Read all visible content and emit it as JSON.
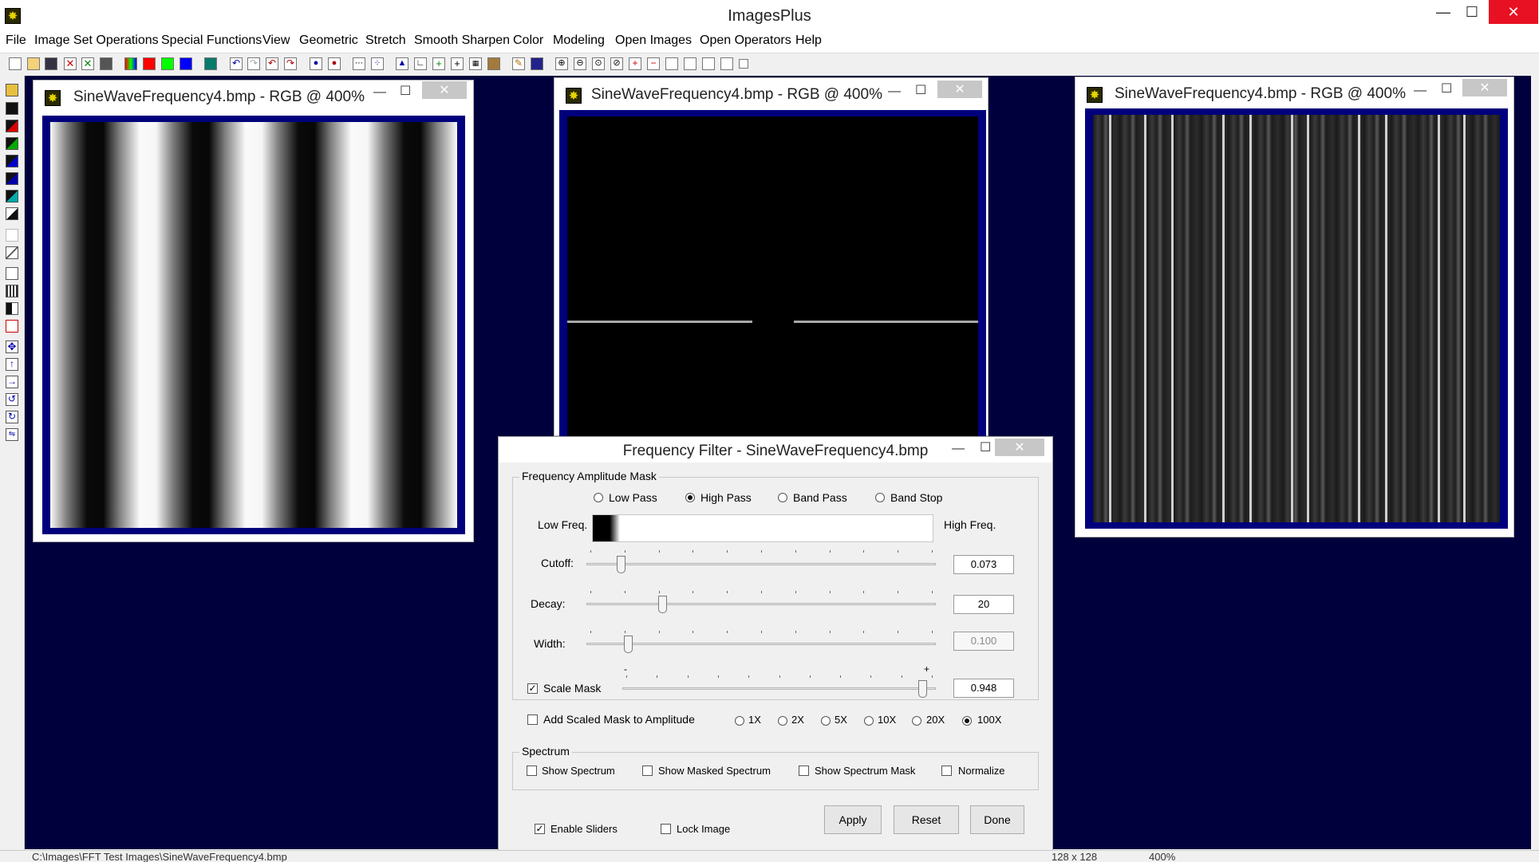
{
  "app": {
    "title": "ImagesPlus",
    "window_buttons": {
      "minimize": "—",
      "maximize": "☐",
      "close": "✕"
    }
  },
  "menu": [
    "File",
    "Image Set Operations",
    "Special Functions",
    "View",
    "Geometric",
    "Stretch",
    "Smooth Sharpen",
    "Color",
    "Modeling",
    "Open Images",
    "Open Operators",
    "Help"
  ],
  "image_windows": [
    {
      "title": "SineWaveFrequency4.bmp - RGB @ 400%"
    },
    {
      "title": "SineWaveFrequency4.bmp - RGB @ 400%"
    },
    {
      "title": "SineWaveFrequency4.bmp - RGB @ 400%"
    }
  ],
  "dialog": {
    "title": "Frequency Filter - SineWaveFrequency4.bmp",
    "amplitude_group": "Frequency Amplitude Mask",
    "filter_types": [
      "Low Pass",
      "High Pass",
      "Band Pass",
      "Band Stop"
    ],
    "selected_filter": "High Pass",
    "low_freq_label": "Low Freq.",
    "high_freq_label": "High Freq.",
    "cutoff": {
      "label": "Cutoff:",
      "value": "0.073",
      "position": 0.09
    },
    "decay": {
      "label": "Decay:",
      "value": "20",
      "position": 0.21
    },
    "width": {
      "label": "Width:",
      "value": "0.100",
      "position": 0.11,
      "disabled": true
    },
    "scale_mask": {
      "label": "Scale Mask",
      "checked": true,
      "value": "0.948",
      "position": 0.97,
      "minus": "-",
      "plus": "+"
    },
    "add_scaled": {
      "label": "Add Scaled Mask to Amplitude",
      "checked": false
    },
    "multipliers": [
      "1X",
      "2X",
      "5X",
      "10X",
      "20X",
      "100X"
    ],
    "selected_multiplier": "100X",
    "spectrum_group": "Spectrum",
    "spectrum_options": [
      {
        "label": "Show Spectrum",
        "checked": false
      },
      {
        "label": "Show Masked Spectrum",
        "checked": false
      },
      {
        "label": "Show Spectrum Mask",
        "checked": false
      },
      {
        "label": "Normalize",
        "checked": false
      }
    ],
    "enable_sliders": {
      "label": "Enable Sliders",
      "checked": true
    },
    "lock_image": {
      "label": "Lock Image",
      "checked": false
    },
    "buttons": {
      "apply": "Apply",
      "reset": "Reset",
      "done": "Done"
    }
  },
  "status": {
    "path": "C:\\Images\\FFT Test Images\\SineWaveFrequency4.bmp",
    "size": "128 x 128",
    "zoom": "400%"
  },
  "colors": {
    "workspace": "#00003c",
    "image_frame": "#00007c",
    "close_red": "#e81123"
  }
}
